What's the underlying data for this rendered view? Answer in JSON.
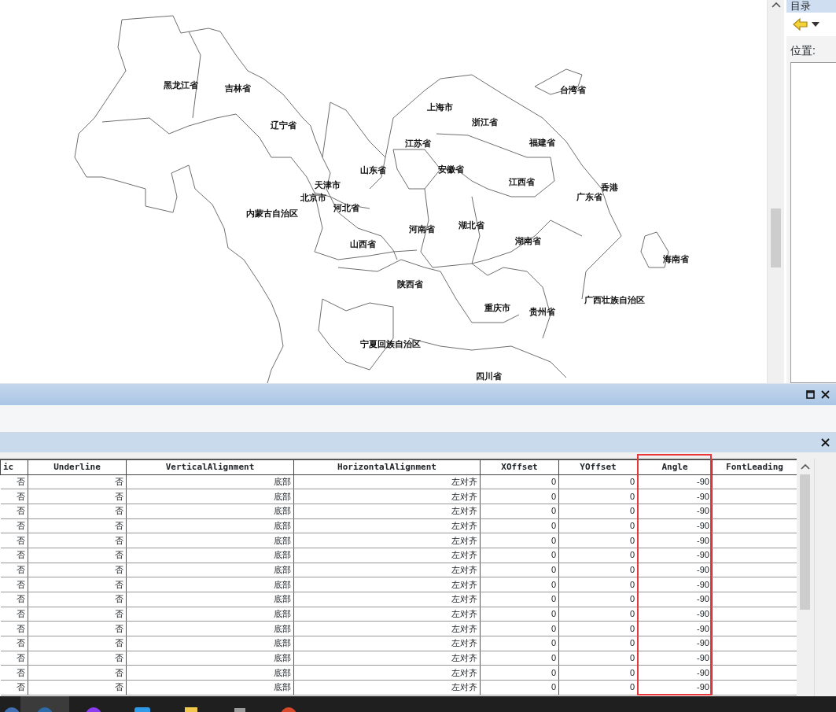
{
  "map": {
    "labels": [
      {
        "text": "黑龙江省"
      },
      {
        "text": "吉林省"
      },
      {
        "text": "辽宁省"
      },
      {
        "text": "山东省"
      },
      {
        "text": "天津市"
      },
      {
        "text": "北京市"
      },
      {
        "text": "河北省"
      },
      {
        "text": "内蒙古自治区"
      },
      {
        "text": "山西省"
      },
      {
        "text": "陕西省"
      },
      {
        "text": "宁夏回族自治区"
      },
      {
        "text": "上海市"
      },
      {
        "text": "江苏省"
      },
      {
        "text": "浙江省"
      },
      {
        "text": "安徽省"
      },
      {
        "text": "福建省"
      },
      {
        "text": "台湾省"
      },
      {
        "text": "江西省"
      },
      {
        "text": "香港"
      },
      {
        "text": "广东省"
      },
      {
        "text": "河南省"
      },
      {
        "text": "湖北省"
      },
      {
        "text": "湖南省"
      },
      {
        "text": "海南省"
      },
      {
        "text": "重庆市"
      },
      {
        "text": "贵州省"
      },
      {
        "text": "广西壮族自治区"
      },
      {
        "text": "四川省"
      }
    ]
  },
  "catalog_panel": {
    "title": "目录",
    "location_label": "位置:"
  },
  "table": {
    "columns": [
      {
        "label": "ic",
        "highlighted": false
      },
      {
        "label": "Underline",
        "highlighted": false
      },
      {
        "label": "VerticalAlignment",
        "highlighted": false
      },
      {
        "label": "HorizontalAlignment",
        "highlighted": false
      },
      {
        "label": "XOffset",
        "highlighted": false
      },
      {
        "label": "YOffset",
        "highlighted": false
      },
      {
        "label": "Angle",
        "highlighted": true
      },
      {
        "label": "FontLeading",
        "highlighted": false
      }
    ],
    "rows": [
      [
        "否",
        "否",
        "底部",
        "左对齐",
        "0",
        "0",
        "-90"
      ],
      [
        "否",
        "否",
        "底部",
        "左对齐",
        "0",
        "0",
        "-90"
      ],
      [
        "否",
        "否",
        "底部",
        "左对齐",
        "0",
        "0",
        "-90"
      ],
      [
        "否",
        "否",
        "底部",
        "左对齐",
        "0",
        "0",
        "-90"
      ],
      [
        "否",
        "否",
        "底部",
        "左对齐",
        "0",
        "0",
        "-90"
      ],
      [
        "否",
        "否",
        "底部",
        "左对齐",
        "0",
        "0",
        "-90"
      ],
      [
        "否",
        "否",
        "底部",
        "左对齐",
        "0",
        "0",
        "-90"
      ],
      [
        "否",
        "否",
        "底部",
        "左对齐",
        "0",
        "0",
        "-90"
      ],
      [
        "否",
        "否",
        "底部",
        "左对齐",
        "0",
        "0",
        "-90"
      ],
      [
        "否",
        "否",
        "底部",
        "左对齐",
        "0",
        "0",
        "-90"
      ],
      [
        "否",
        "否",
        "底部",
        "左对齐",
        "0",
        "0",
        "-90"
      ],
      [
        "否",
        "否",
        "底部",
        "左对齐",
        "0",
        "0",
        "-90"
      ],
      [
        "否",
        "否",
        "底部",
        "左对齐",
        "0",
        "0",
        "-90"
      ],
      [
        "否",
        "否",
        "底部",
        "左对齐",
        "0",
        "0",
        "-90"
      ],
      [
        "否",
        "否",
        "底部",
        "左对齐",
        "0",
        "0",
        "-90"
      ]
    ]
  }
}
